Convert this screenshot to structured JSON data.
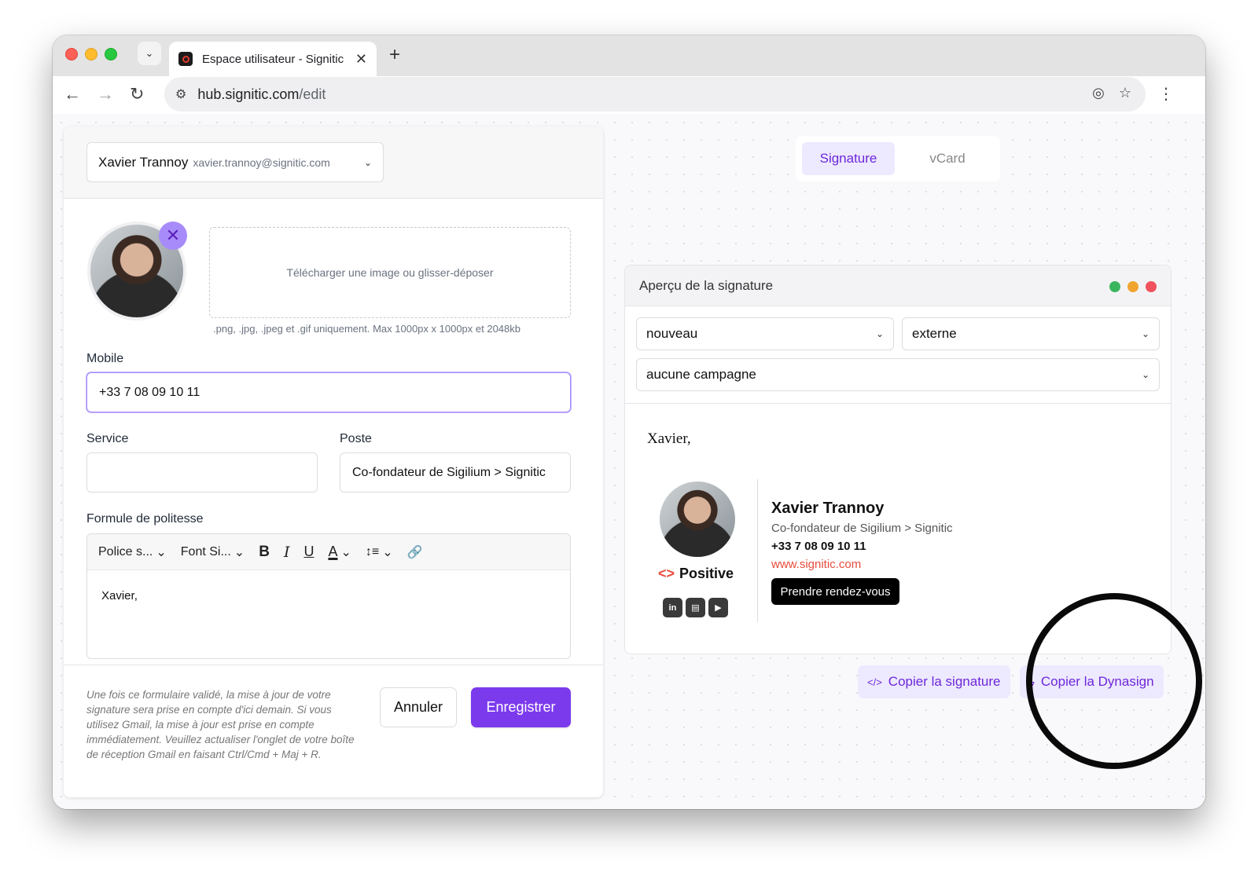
{
  "browser": {
    "tab_title": "Espace utilisateur - Signitic",
    "url_host": "hub.signitic.com",
    "url_path": "/edit",
    "icons": {
      "tab_menu": "chevron-down-icon",
      "close_tab": "close-icon",
      "new_tab": "plus-icon",
      "back": "arrow-left-icon",
      "forward": "arrow-right-icon",
      "reload": "reload-icon",
      "site_info": "tune-icon",
      "eye_off": "eye-off-icon",
      "bookmark": "star-icon",
      "menu": "kebab-icon"
    }
  },
  "form": {
    "user_name": "Xavier Trannoy",
    "user_email": "xavier.trannoy@signitic.com",
    "dropzone_text": "Télécharger une image ou glisser-déposer",
    "dropzone_hint": ".png, .jpg, .jpeg et .gif uniquement. Max 1000px x 1000px et 2048kb",
    "mobile_label": "Mobile",
    "mobile_value": "+33 7 08 09 10 11",
    "service_label": "Service",
    "service_value": "",
    "poste_label": "Poste",
    "poste_value": "Co-fondateur de Sigilium > Signitic",
    "formule_label": "Formule de politesse",
    "editor_toolbar": {
      "font_family": "Police s...",
      "font_size": "Font Si..."
    },
    "formule_value": "Xavier,",
    "footer_note": "Une fois ce formulaire validé, la mise à jour de votre signature sera prise en compte d'ici demain. Si vous utilisez Gmail, la mise à jour est prise en compte immédiatement. Veuillez actualiser l'onglet de votre boîte de réception Gmail en faisant Ctrl/Cmd + Maj + R.",
    "cancel_label": "Annuler",
    "save_label": "Enregistrer"
  },
  "view_toggle": {
    "signature_label": "Signature",
    "vcard_label": "vCard",
    "active": "Signature"
  },
  "preview": {
    "title": "Aperçu de la signature",
    "select_status": "nouveau",
    "select_audience": "externe",
    "select_campaign": "aucune campagne",
    "signature": {
      "greeting": "Xavier,",
      "name": "Xavier Trannoy",
      "role": "Co-fondateur de Sigilium > Signitic",
      "phone": "+33 7 08 09 10 11",
      "website": "www.signitic.com",
      "cta": "Prendre rendez-vous",
      "logo_text": "Positive",
      "socials": [
        "linkedin-icon",
        "vcard-icon",
        "youtube-icon"
      ]
    }
  },
  "actions": {
    "copy_signature": "Copier la signature",
    "copy_dynasign": "Copier la Dynasign"
  },
  "colors": {
    "accent": "#7c3aed",
    "accent_light": "#ede9fe",
    "brand_red": "#e74c3c"
  }
}
